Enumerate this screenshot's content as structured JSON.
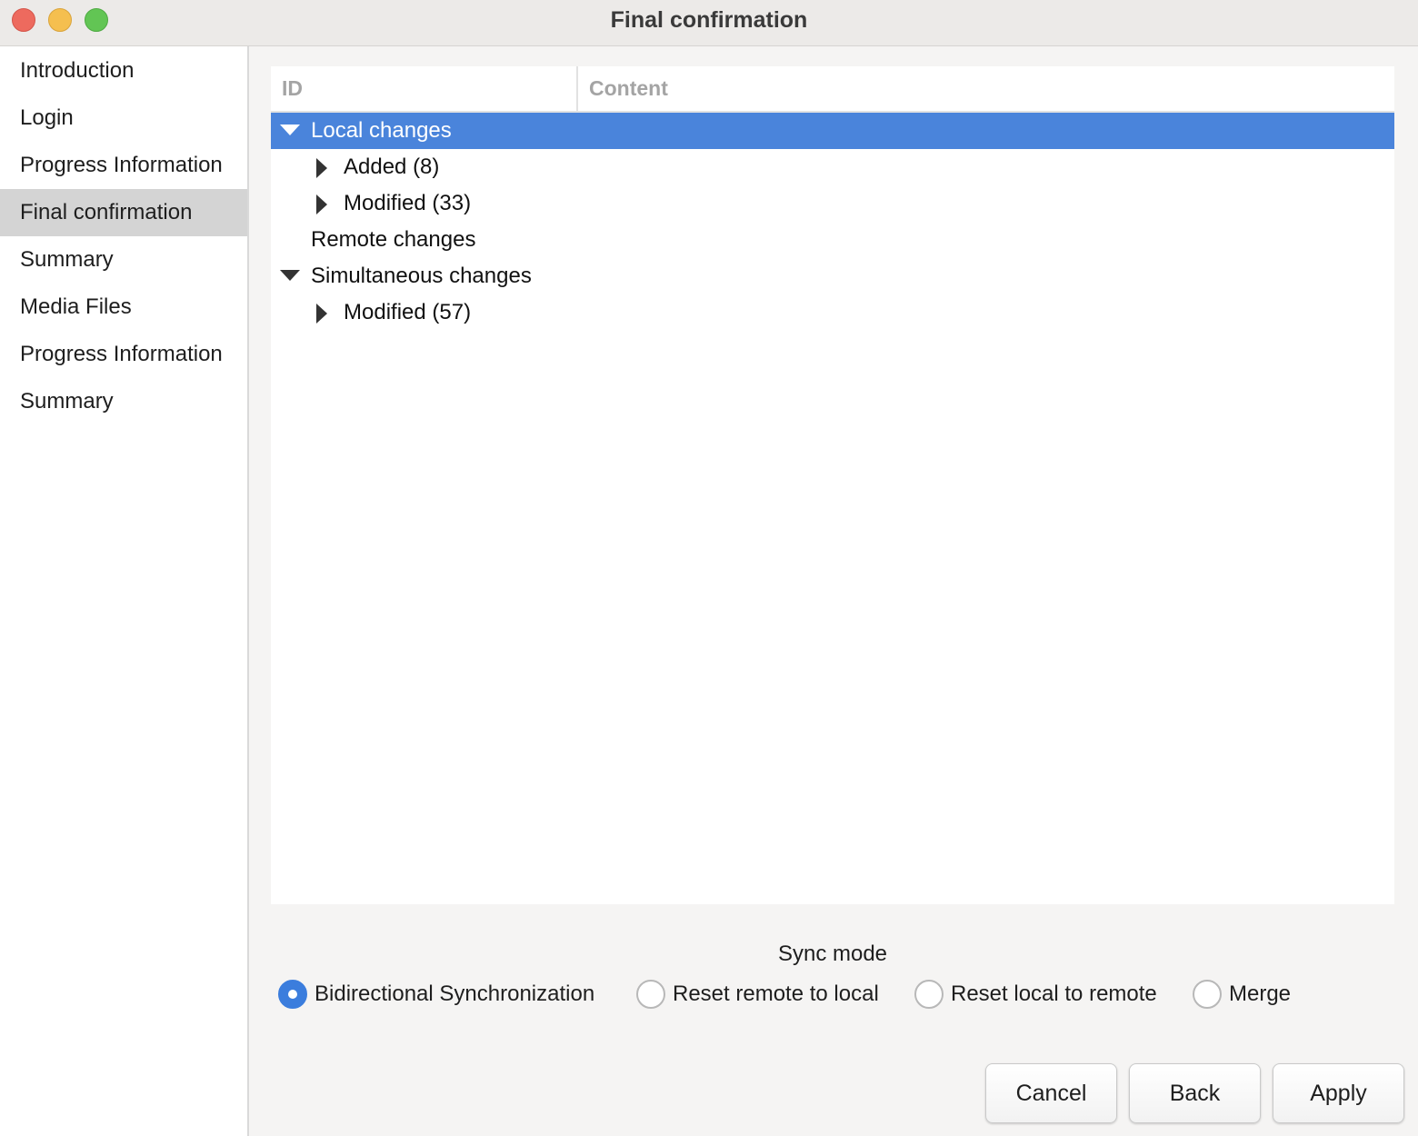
{
  "window": {
    "title": "Final confirmation",
    "controls": [
      "close",
      "minimize",
      "maximize"
    ]
  },
  "sidebar": {
    "items": [
      {
        "label": "Introduction",
        "selected": false
      },
      {
        "label": "Login",
        "selected": false
      },
      {
        "label": "Progress Information",
        "selected": false
      },
      {
        "label": "Final confirmation",
        "selected": true
      },
      {
        "label": "Summary",
        "selected": false
      },
      {
        "label": "Media Files",
        "selected": false
      },
      {
        "label": "Progress Information",
        "selected": false
      },
      {
        "label": "Summary",
        "selected": false
      }
    ]
  },
  "tree": {
    "columns": [
      "ID",
      "Content"
    ],
    "rows": [
      {
        "label": "Local changes",
        "level": 0,
        "arrow": "expanded",
        "selected": true
      },
      {
        "label": "Added (8)",
        "level": 1,
        "arrow": "collapsed",
        "selected": false
      },
      {
        "label": "Modified (33)",
        "level": 1,
        "arrow": "collapsed",
        "selected": false
      },
      {
        "label": "Remote changes",
        "level": 0,
        "arrow": "none",
        "selected": false
      },
      {
        "label": "Simultaneous changes",
        "level": 0,
        "arrow": "expanded",
        "selected": false
      },
      {
        "label": "Modified (57)",
        "level": 1,
        "arrow": "collapsed",
        "selected": false
      }
    ]
  },
  "sync": {
    "label": "Sync mode",
    "options": [
      {
        "label": "Bidirectional Synchronization",
        "checked": true
      },
      {
        "label": "Reset remote to local",
        "checked": false
      },
      {
        "label": "Reset local to remote",
        "checked": false
      },
      {
        "label": "Merge",
        "checked": false
      }
    ]
  },
  "buttons": {
    "cancel": "Cancel",
    "back": "Back",
    "apply": "Apply"
  },
  "colors": {
    "selection": "#4a84db",
    "radio_checked": "#3b7ddd",
    "sidebar_selected": "#d4d4d4"
  }
}
